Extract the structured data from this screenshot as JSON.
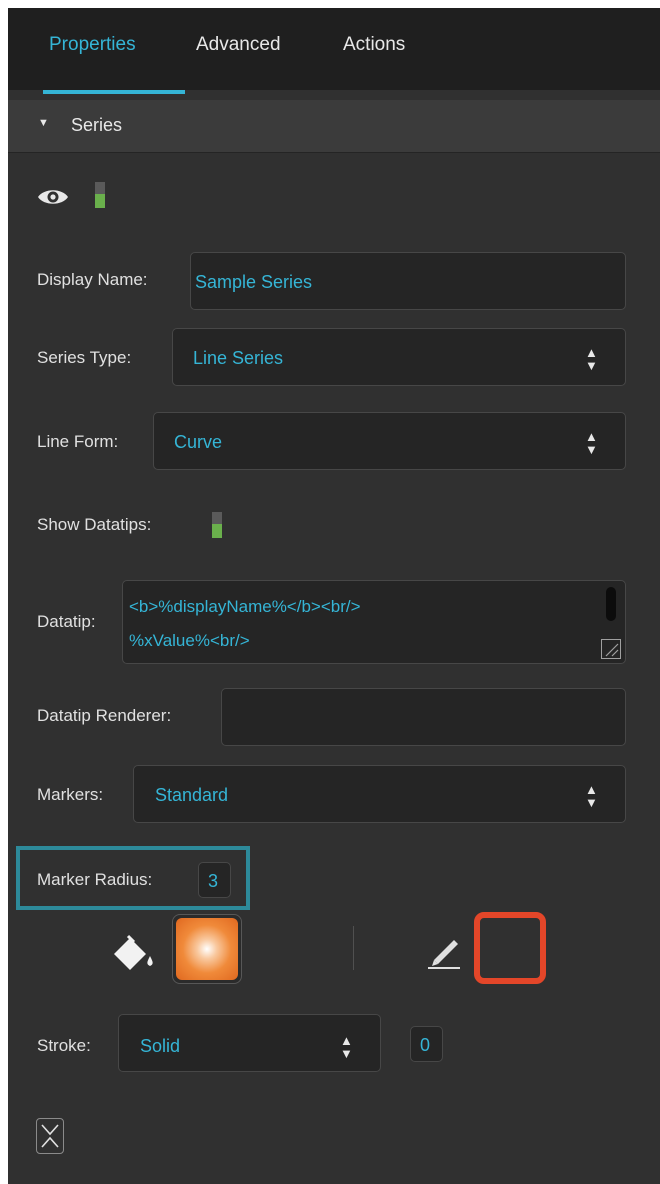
{
  "tabs": [
    {
      "label": "Properties",
      "active": true
    },
    {
      "label": "Advanced",
      "active": false
    },
    {
      "label": "Actions",
      "active": false
    }
  ],
  "section": {
    "title": "Series",
    "expanded": true
  },
  "visibility": {
    "icon": "eye-icon",
    "enabled": true
  },
  "fields": {
    "display_name": {
      "label": "Display Name:",
      "value": "Sample Series"
    },
    "series_type": {
      "label": "Series Type:",
      "value": "Line Series"
    },
    "line_form": {
      "label": "Line Form:",
      "value": "Curve"
    },
    "show_datatips": {
      "label": "Show Datatips:",
      "enabled": true
    },
    "datatip": {
      "label": "Datatip:",
      "lines": [
        "<b>%displayName%</b><br/>",
        "%xValue%<br/>"
      ]
    },
    "datatip_renderer": {
      "label": "Datatip Renderer:",
      "value": ""
    },
    "markers": {
      "label": "Markers:",
      "value": "Standard"
    },
    "marker_radius": {
      "label": "Marker Radius:",
      "value": "3"
    },
    "stroke": {
      "label": "Stroke:",
      "value": "Solid",
      "width": "0"
    }
  },
  "colors": {
    "accent": "#35b5d6",
    "toggle_on": "#6ab04c",
    "fill_swatch": "#f08a3a",
    "stroke_swatch": "#e34629",
    "highlight": "#2d8a9a"
  },
  "icons": {
    "fill": "paint-bucket-icon",
    "stroke": "pencil-icon",
    "collapse": "collapse-icon",
    "select": "up-down-arrows-icon"
  }
}
